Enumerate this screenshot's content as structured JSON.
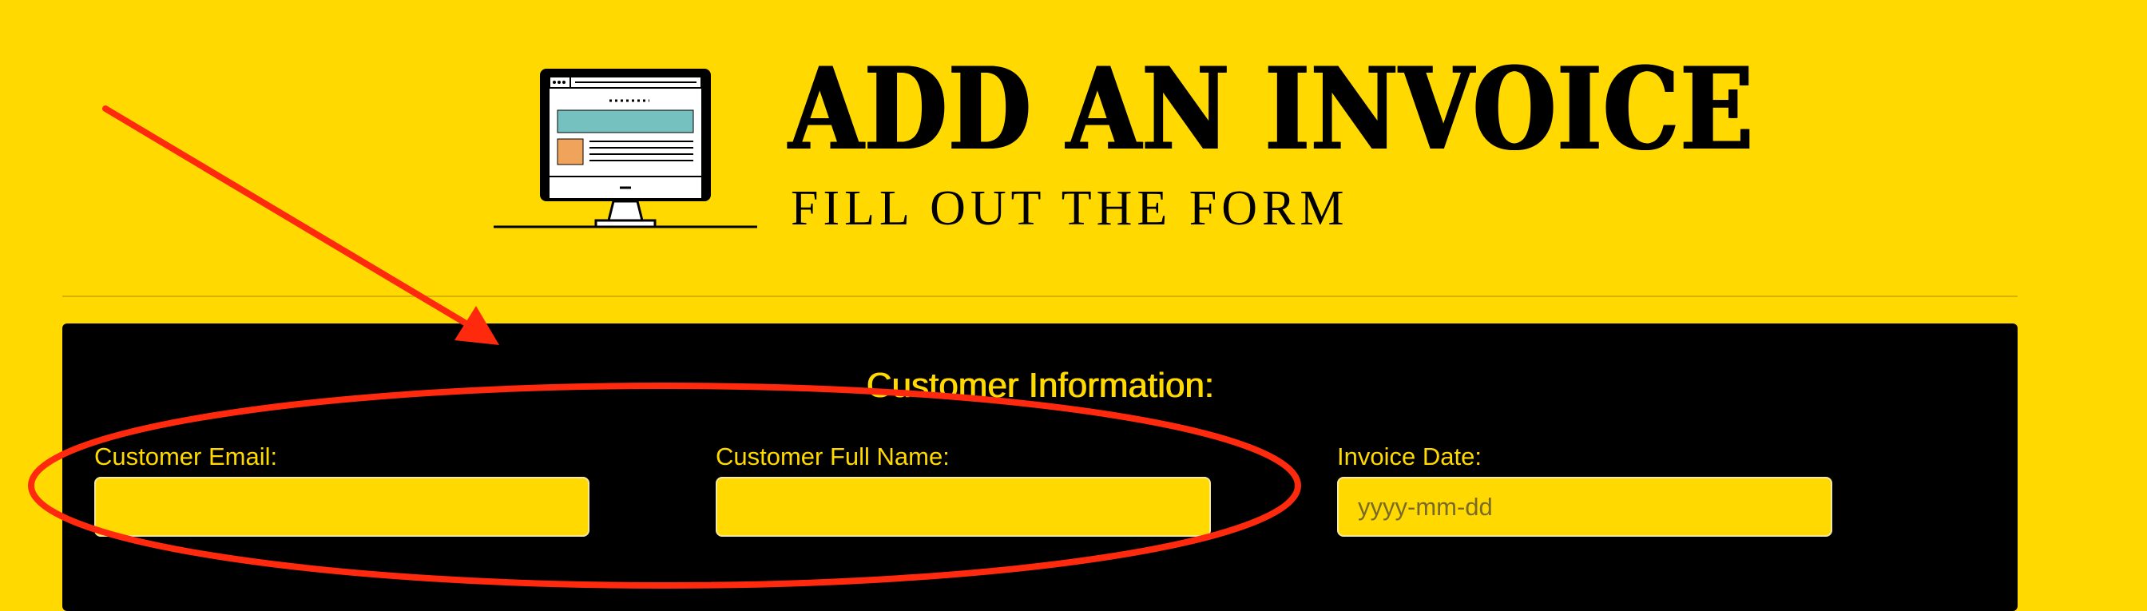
{
  "header": {
    "title": "ADD AN INVOICE",
    "subtitle": "FILL OUT THE FORM"
  },
  "form": {
    "section_title": "Customer Information:",
    "fields": [
      {
        "label": "Customer Email:",
        "value": "",
        "placeholder": ""
      },
      {
        "label": "Customer Full Name:",
        "value": "",
        "placeholder": ""
      },
      {
        "label": "Invoice Date:",
        "value": "",
        "placeholder": "yyyy-mm-dd"
      }
    ]
  },
  "icons": {
    "monitor": "computer-monitor-icon"
  },
  "colors": {
    "background": "#ffd900",
    "card": "#000000",
    "accent": "#ffd900",
    "annotation": "#ff2a0e",
    "monitor_banner": "#74c1c0",
    "monitor_block": "#f0a35a"
  }
}
